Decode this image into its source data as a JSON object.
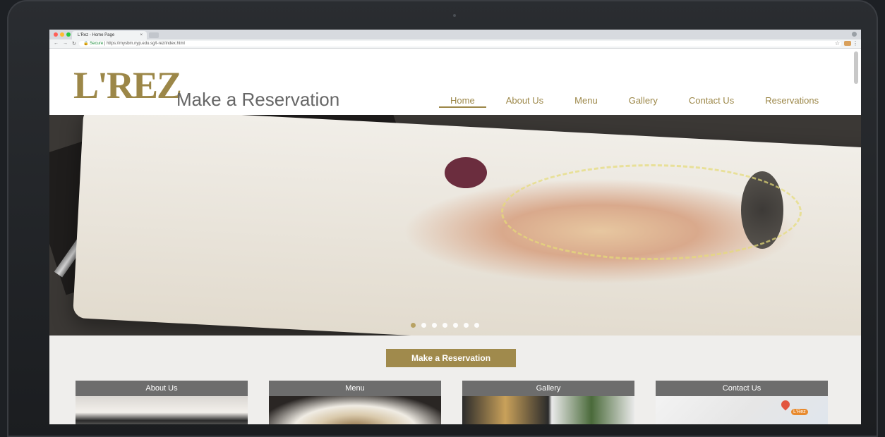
{
  "browser": {
    "tab_title": "L'Rez - Home Page",
    "tab_close": "×",
    "secure_label": "Secure",
    "url": "https://mysbm.nyp.edu.sg/l-rez/index.html"
  },
  "site": {
    "logo_text": "L'REZ",
    "tagline": "Make a Reservation",
    "nav": [
      {
        "label": "Home",
        "active": true
      },
      {
        "label": "About Us"
      },
      {
        "label": "Menu"
      },
      {
        "label": "Gallery"
      },
      {
        "label": "Contact Us"
      },
      {
        "label": "Reservations"
      }
    ],
    "slider": {
      "count": 7,
      "active_index": 0
    },
    "cta_label": "Make a Reservation",
    "cards": [
      {
        "title": "About Us"
      },
      {
        "title": "Menu"
      },
      {
        "title": "Gallery"
      },
      {
        "title": "Contact Us"
      }
    ],
    "map_pin_label": "L'Rez",
    "colors": {
      "accent": "#a08a4c",
      "card_header": "#6d6d6d",
      "page_bg": "#efeeec"
    }
  }
}
